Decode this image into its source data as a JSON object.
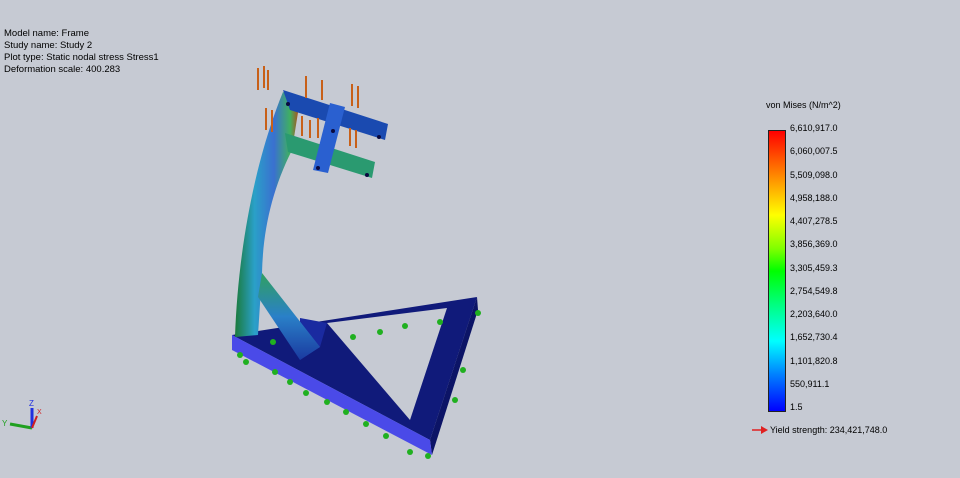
{
  "info": {
    "model_name": "Model name: Frame",
    "study_name": "Study name: Study 2",
    "plot_type": "Plot type: Static nodal stress Stress1",
    "deformation_scale": "Deformation scale: 400.283"
  },
  "legend": {
    "title": "von Mises (N/m^2)",
    "ticks": [
      "6,610,917.0",
      "6,060,007.5",
      "5,509,098.0",
      "4,958,188.0",
      "4,407,278.5",
      "3,856,369.0",
      "3,305,459.3",
      "2,754,549.8",
      "2,203,640.0",
      "1,652,730.4",
      "1,101,820.8",
      "550,911.1",
      "1.5"
    ],
    "yield_strength": "Yield strength: 234,421,748.0",
    "yield_arrow_color": "#e02020"
  },
  "triad": {
    "x": "X",
    "y": "Y",
    "z": "Z"
  }
}
